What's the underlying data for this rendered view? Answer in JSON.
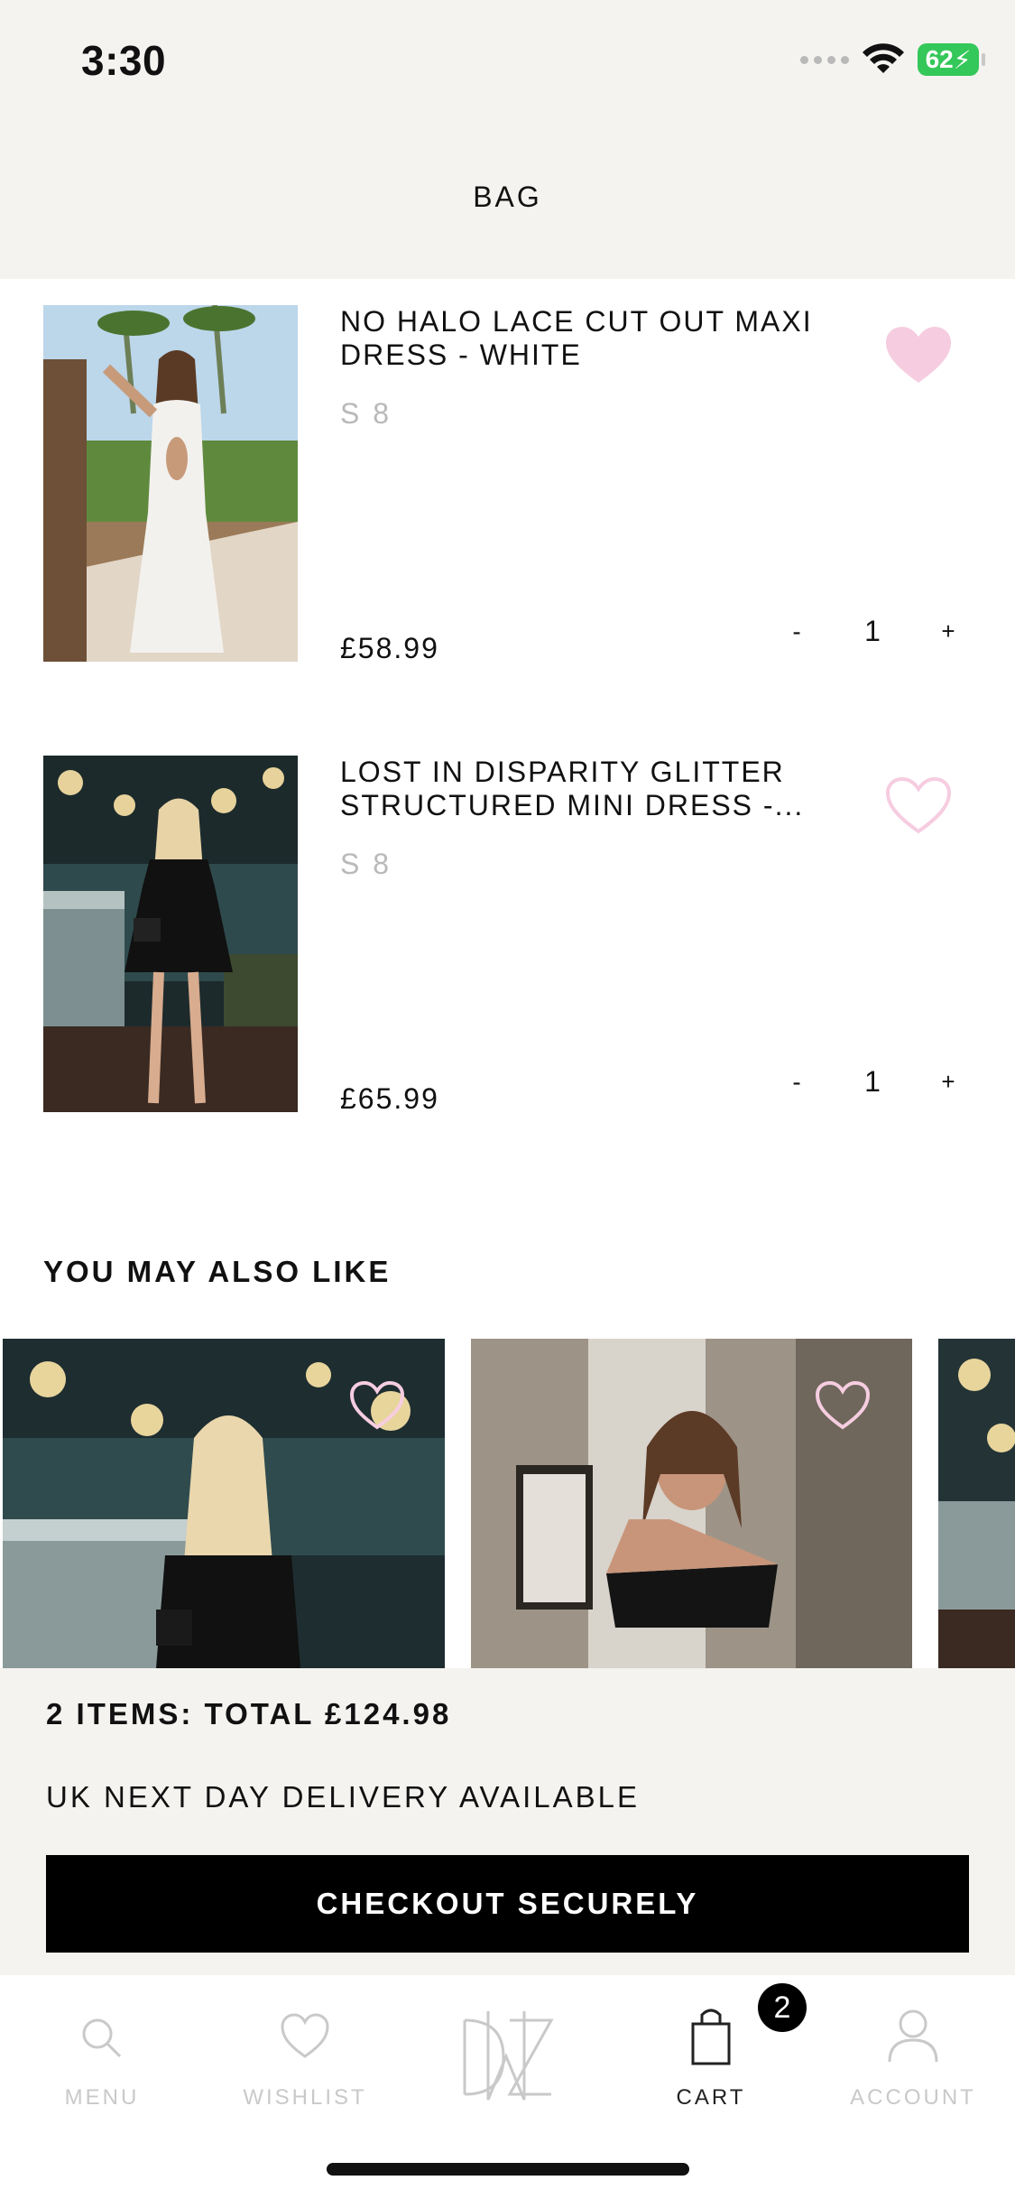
{
  "status_bar": {
    "time": "3:30",
    "battery": "62"
  },
  "header": {
    "title": "BAG"
  },
  "bag_items": [
    {
      "name": "NO HALO LACE CUT OUT MAXI DRESS - WHITE",
      "size": "S 8",
      "price": "£58.99",
      "quantity": "1",
      "wishlisted": true
    },
    {
      "name": "LOST IN DISPARITY GLITTER STRUCTURED MINI DRESS -...",
      "size": "S 8",
      "price": "£65.99",
      "quantity": "1",
      "wishlisted": false
    }
  ],
  "quantity_controls": {
    "minus": "-",
    "plus": "+"
  },
  "recommendations": {
    "title": "YOU MAY ALSO LIKE"
  },
  "summary": {
    "total": "2 ITEMS: TOTAL £124.98",
    "delivery": "UK NEXT DAY DELIVERY AVAILABLE",
    "checkout_label": "CHECKOUT SECURELY"
  },
  "bottom_nav": {
    "items": [
      {
        "label": "MENU",
        "icon": "search-icon"
      },
      {
        "label": "WISHLIST",
        "icon": "heart-icon"
      },
      {
        "label": "",
        "icon": "dmz-logo"
      },
      {
        "label": "CART",
        "icon": "bag-icon",
        "active": true
      },
      {
        "label": "ACCOUNT",
        "icon": "person-icon"
      }
    ],
    "cart_count": "2"
  },
  "colors": {
    "accent_pink": "#f6c9dd",
    "background": "#f4f3f0",
    "checkout": "#000000"
  }
}
